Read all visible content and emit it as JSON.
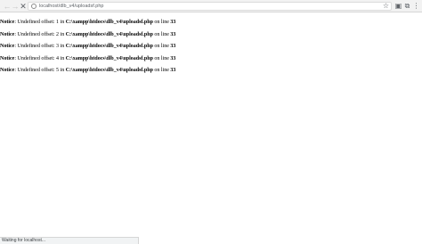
{
  "browser": {
    "url": "localhost/dlb_v4/uploadsf.php",
    "icons": {
      "back": "arrow-left-icon",
      "forward": "arrow-right-icon",
      "stop": "close-icon",
      "info": "info-icon",
      "bookmark": "star-icon",
      "extension1": "extension-icon",
      "extension2": "extension-icon",
      "menu": "menu-icon"
    }
  },
  "notices": [
    {
      "label": "Notice",
      "message": ": Undefined offset: 1 in ",
      "path": "C:\\xampp\\htdocs\\dlb_v4\\uploadsf.php",
      "line_text": " on line ",
      "line": "33"
    },
    {
      "label": "Notice",
      "message": ": Undefined offset: 2 in ",
      "path": "C:\\xampp\\htdocs\\dlb_v4\\uploadsf.php",
      "line_text": " on line ",
      "line": "33"
    },
    {
      "label": "Notice",
      "message": ": Undefined offset: 3 in ",
      "path": "C:\\xampp\\htdocs\\dlb_v4\\uploadsf.php",
      "line_text": " on line ",
      "line": "33"
    },
    {
      "label": "Notice",
      "message": ": Undefined offset: 4 in ",
      "path": "C:\\xampp\\htdocs\\dlb_v4\\uploadsf.php",
      "line_text": " on line ",
      "line": "33"
    },
    {
      "label": "Notice",
      "message": ": Undefined offset: 5 in ",
      "path": "C:\\xampp\\htdocs\\dlb_v4\\uploadsf.php",
      "line_text": " on line ",
      "line": "33"
    }
  ],
  "status_bar": {
    "text": "Waiting for localhost..."
  }
}
